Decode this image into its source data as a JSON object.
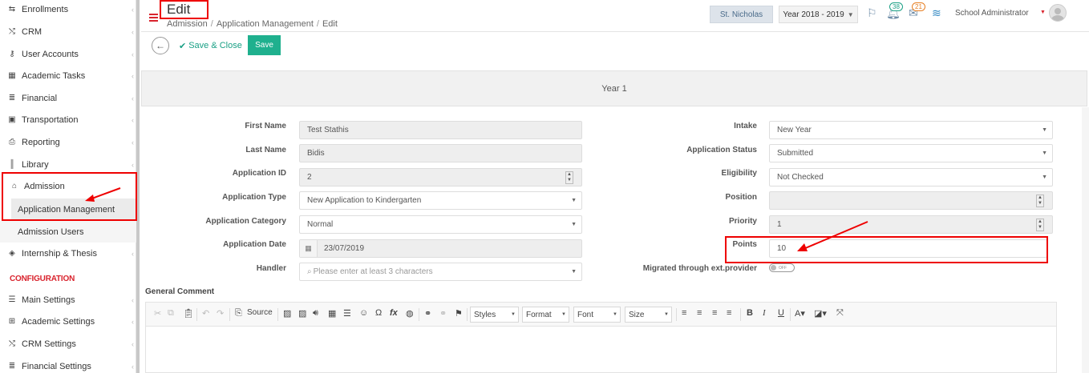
{
  "sidebar": {
    "items": [
      {
        "label": "Enrollments",
        "icon": "enrollments-icon"
      },
      {
        "label": "CRM",
        "icon": "crm-icon"
      },
      {
        "label": "User Accounts",
        "icon": "key-icon"
      },
      {
        "label": "Academic Tasks",
        "icon": "grid-icon"
      },
      {
        "label": "Financial",
        "icon": "coins-icon"
      },
      {
        "label": "Transportation",
        "icon": "bus-icon"
      },
      {
        "label": "Reporting",
        "icon": "printer-icon"
      },
      {
        "label": "Library",
        "icon": "books-icon"
      },
      {
        "label": "Admission",
        "icon": "bank-icon"
      }
    ],
    "admission_sub": [
      "Application Management",
      "Admission Users"
    ],
    "after": [
      {
        "label": "Internship & Thesis",
        "icon": "cube-icon"
      }
    ],
    "config_title": "CONFIGURATION",
    "config_items": [
      {
        "label": "Main Settings",
        "icon": "sliders-icon"
      },
      {
        "label": "Academic Settings",
        "icon": "org-icon"
      },
      {
        "label": "CRM Settings",
        "icon": "crm-icon"
      },
      {
        "label": "Financial Settings",
        "icon": "coins-icon"
      }
    ]
  },
  "header": {
    "title": "Edit",
    "breadcrumb": [
      "Admission",
      "Application Management",
      "Edit"
    ],
    "school": "St. Nicholas",
    "year": "Year 2018 - 2019",
    "notif_count": "38",
    "message_count": "21",
    "user": "School Administrator"
  },
  "toolbar": {
    "save_close_label": "Save & Close",
    "save_label": "Save"
  },
  "panel_title": "Year 1",
  "form": {
    "left": [
      {
        "label": "First Name",
        "value": "Test Stathis"
      },
      {
        "label": "Last Name",
        "value": "Bidis"
      },
      {
        "label": "Application ID",
        "value": "2"
      },
      {
        "label": "Application Type",
        "value": "New Application to Kindergarten"
      },
      {
        "label": "Application Category",
        "value": "Normal"
      },
      {
        "label": "Application Date",
        "value": "23/07/2019"
      },
      {
        "label": "Handler",
        "placeholder": "Please enter at least 3 characters"
      }
    ],
    "right": [
      {
        "label": "Intake",
        "value": "New Year"
      },
      {
        "label": "Application Status",
        "value": "Submitted"
      },
      {
        "label": "Eligibility",
        "value": "Not Checked"
      },
      {
        "label": "Position",
        "value": ""
      },
      {
        "label": "Priority",
        "value": "1"
      },
      {
        "label": "Points",
        "value": "10"
      },
      {
        "label": "Migrated through ext.provider",
        "toggle": "OFF"
      }
    ],
    "general_comment_label": "General Comment"
  },
  "editor": {
    "source_label": "Source",
    "combos": [
      "Styles",
      "Format",
      "Font",
      "Size"
    ]
  },
  "colors": {
    "accent": "#1fb08e",
    "brand_red": "#d9232d",
    "annotation": "#ee0000"
  }
}
